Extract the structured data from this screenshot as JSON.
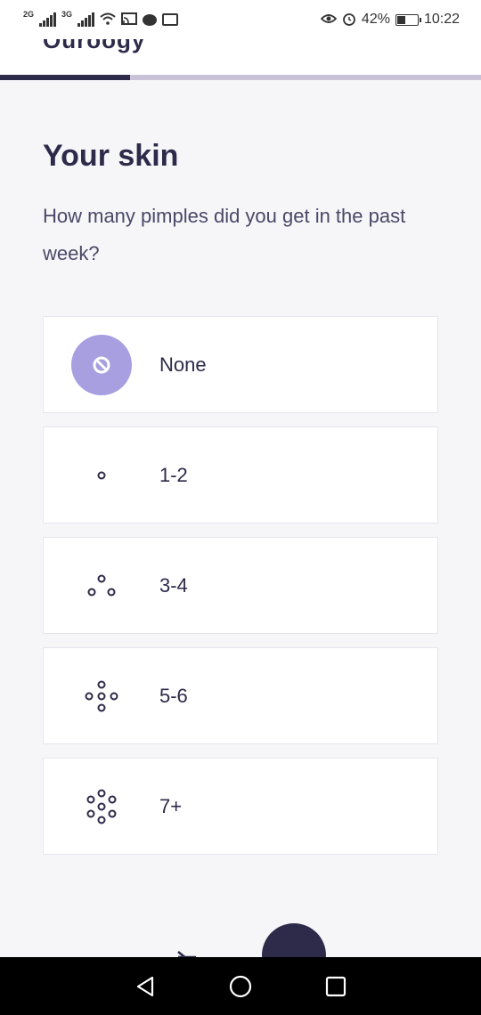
{
  "status_bar": {
    "network_1": "2G",
    "network_2": "3G",
    "battery_percent": "42%",
    "battery_level": 0.42,
    "time": "10:22"
  },
  "header": {
    "title_cut": "Ouroogy",
    "progress_fraction": 0.27
  },
  "main": {
    "title": "Your skin",
    "question": "How many pimples did you get in the past week?",
    "options": [
      {
        "label": "None",
        "icon": "no-symbol-icon",
        "selected": true
      },
      {
        "label": "1-2",
        "icon": "one-dot-icon",
        "selected": false
      },
      {
        "label": "3-4",
        "icon": "three-dots-icon",
        "selected": false
      },
      {
        "label": "5-6",
        "icon": "five-dots-icon",
        "selected": false
      },
      {
        "label": "7+",
        "icon": "seven-dots-icon",
        "selected": false
      }
    ]
  },
  "navigation": {
    "back_icon": "arrow-left-icon",
    "next_icon": "arrow-right-icon"
  },
  "colors": {
    "primary": "#2d2a4a",
    "accent": "#a79fe0",
    "background": "#f6f6f9",
    "progress_track": "#c9c3da"
  }
}
